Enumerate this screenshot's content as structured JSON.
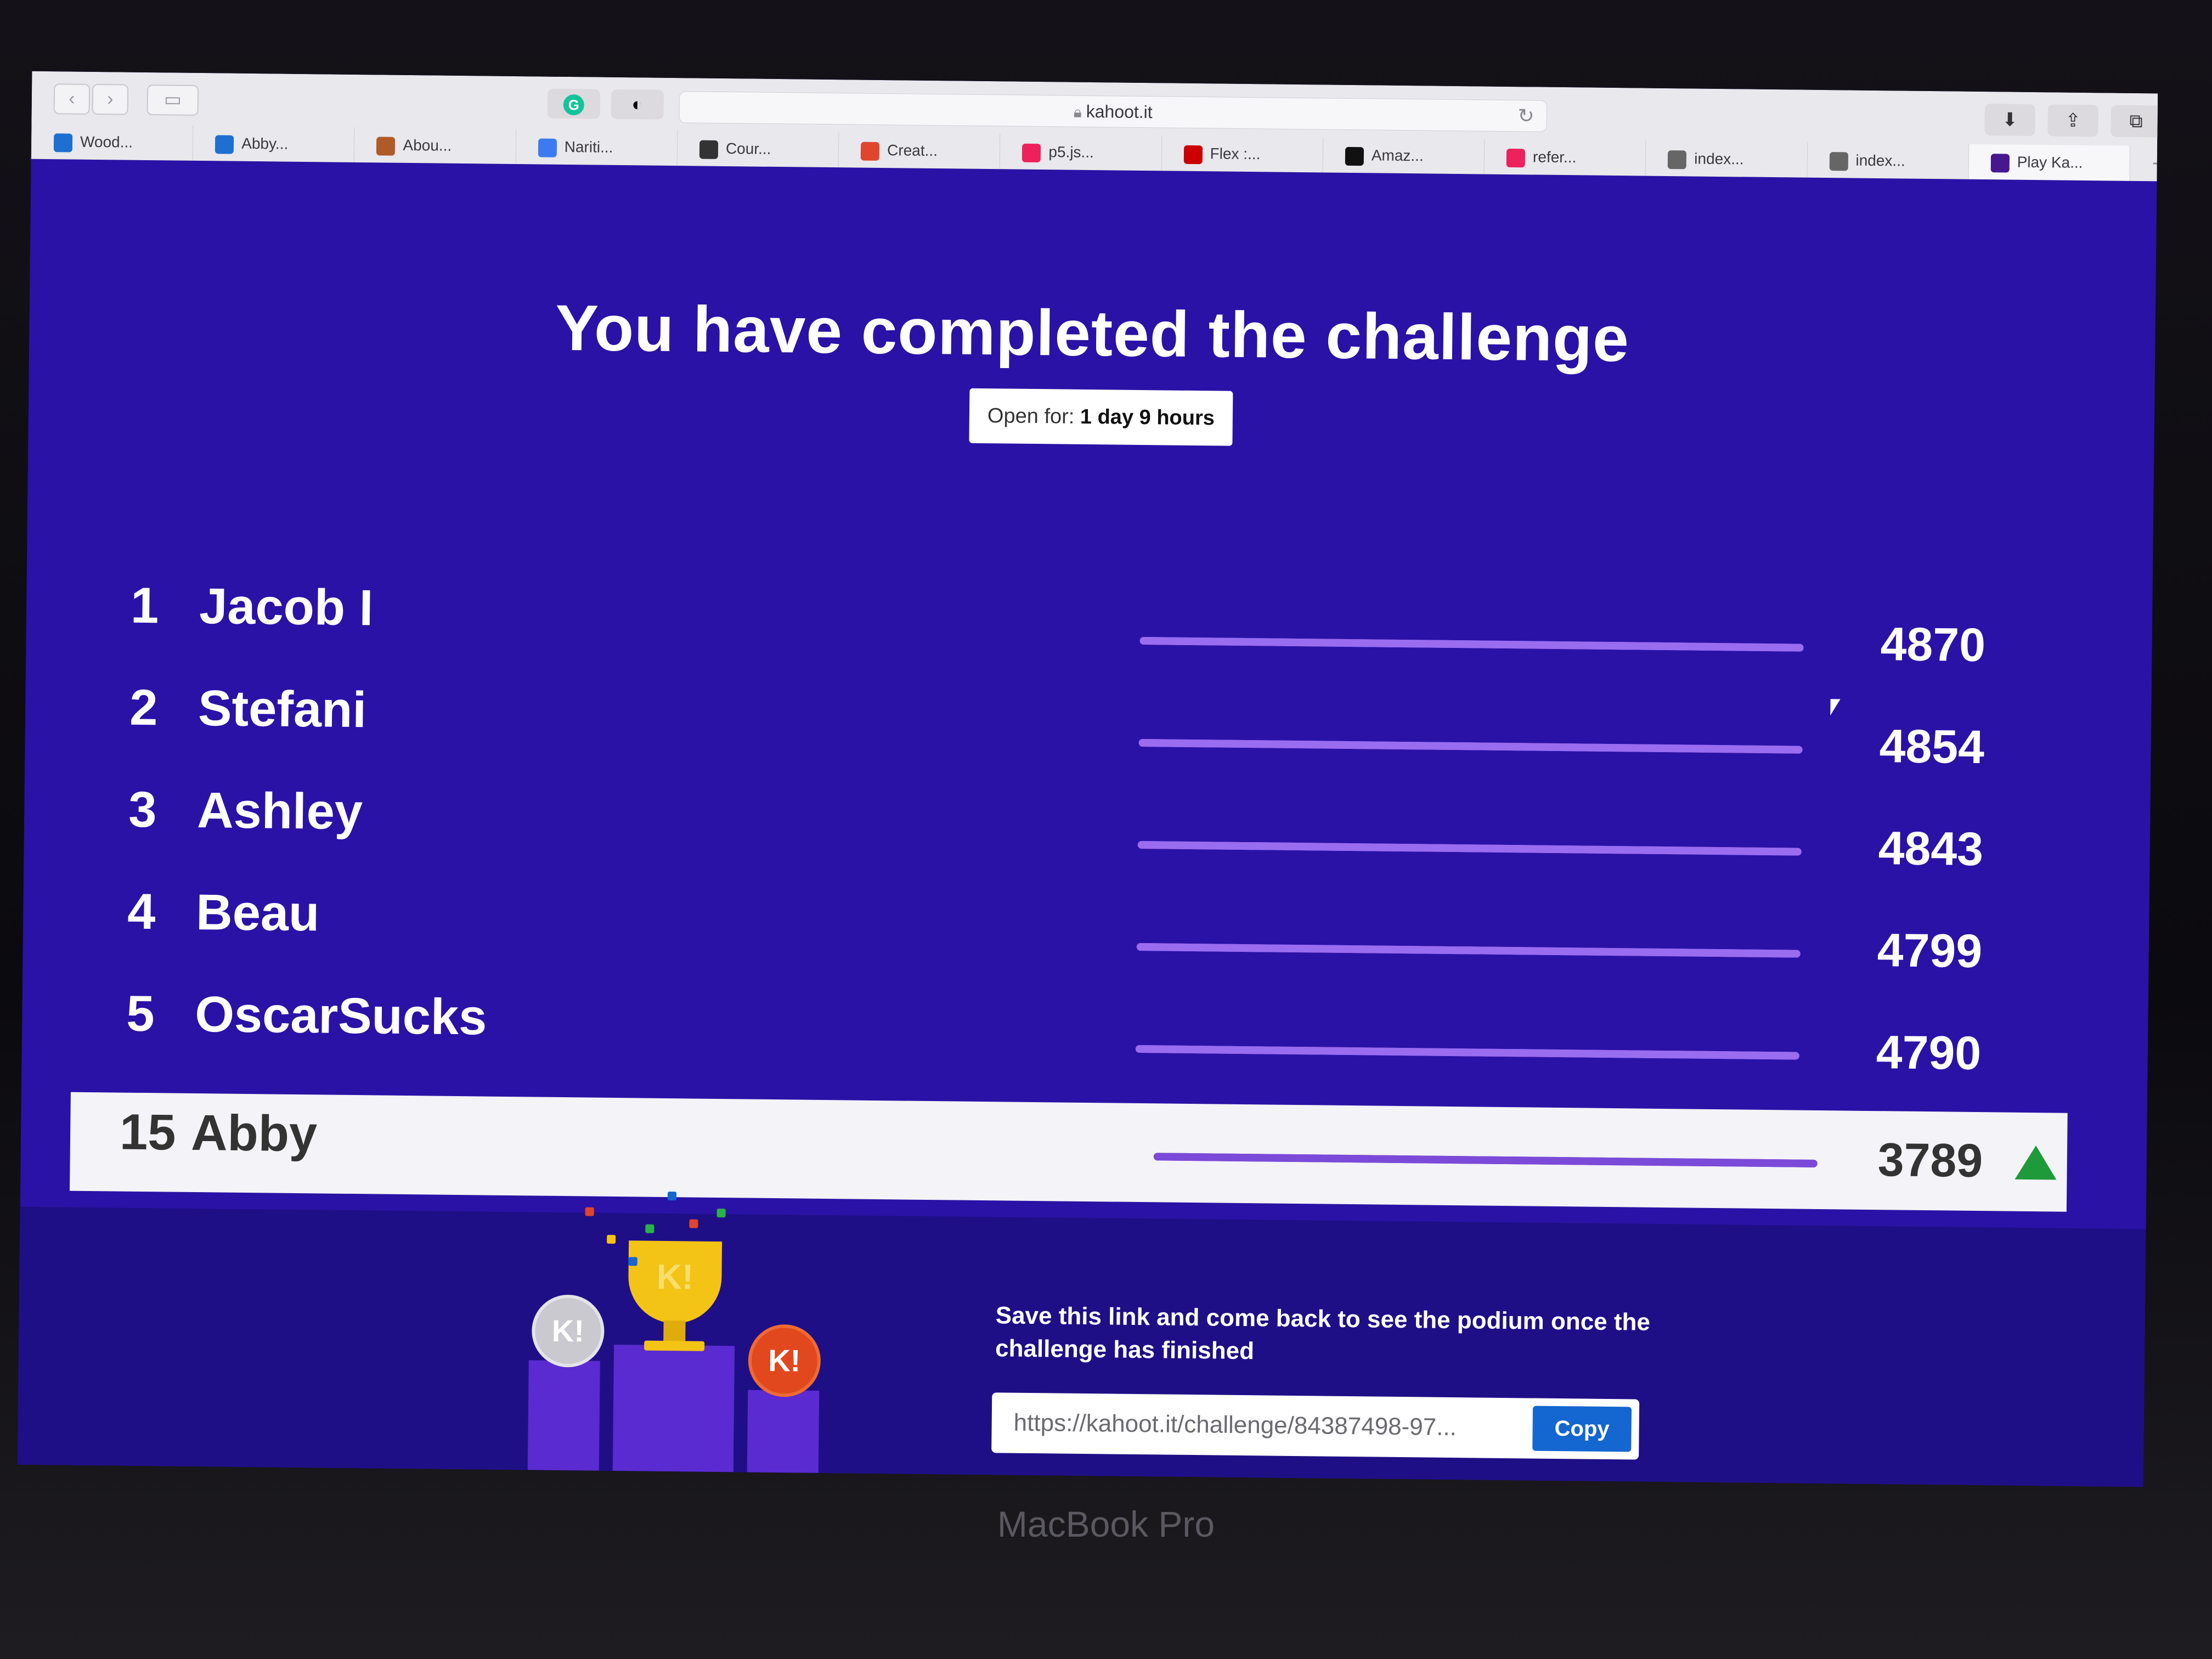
{
  "browser": {
    "address": "kahoot.it",
    "tabs": [
      {
        "label": "Wood...",
        "icon": "outlook-icon",
        "color": "#1f6fd1"
      },
      {
        "label": "Abby...",
        "icon": "outlook-icon",
        "color": "#1f6fd1"
      },
      {
        "label": "Abou...",
        "icon": "app-icon",
        "color": "#b05a2a"
      },
      {
        "label": "Nariti...",
        "icon": "docs-icon",
        "color": "#3b7af0"
      },
      {
        "label": "Cour...",
        "icon": "power-icon",
        "color": "#333333"
      },
      {
        "label": "Creat...",
        "icon": "drive-icon",
        "color": "#e0452e"
      },
      {
        "label": "p5.js...",
        "icon": "asterisk-icon",
        "color": "#ed225d"
      },
      {
        "label": "Flex :...",
        "icon": "target-icon",
        "color": "#cc0000"
      },
      {
        "label": "Amaz...",
        "icon": "amazon-icon",
        "color": "#111111"
      },
      {
        "label": "refer...",
        "icon": "asterisk-icon",
        "color": "#ed225d"
      },
      {
        "label": "index...",
        "icon": "compass-icon",
        "color": "#666666"
      },
      {
        "label": "index...",
        "icon": "compass-icon",
        "color": "#666666"
      },
      {
        "label": "Play Ka...",
        "icon": "kahoot-icon",
        "color": "#46178f"
      }
    ]
  },
  "page": {
    "title": "You have completed the challenge",
    "open_label": "Open for: ",
    "open_value": "1 day 9 hours"
  },
  "leaderboard": [
    {
      "rank": "1",
      "name": "Jacob I",
      "score": "4870",
      "fill": 1.0
    },
    {
      "rank": "2",
      "name": "Stefani",
      "score": "4854",
      "fill": 1.0
    },
    {
      "rank": "3",
      "name": "Ashley",
      "score": "4843",
      "fill": 1.0
    },
    {
      "rank": "4",
      "name": "Beau",
      "score": "4799",
      "fill": 1.0
    },
    {
      "rank": "5",
      "name": "OscarSucks",
      "score": "4790",
      "fill": 1.0
    }
  ],
  "me": {
    "rank": "15",
    "name": "Abby",
    "score": "3789",
    "fill": 1.0,
    "trend": "up-arrow-icon"
  },
  "footer": {
    "save_text": "Save this link and come back to see the podium once the challenge has finished",
    "link": "https://kahoot.it/challenge/84387498-97...",
    "copy_label": "Copy"
  },
  "device": {
    "label": "MacBook Pro"
  },
  "colors": {
    "page_bg": "#2a12a6",
    "bar": "#9a6cf0",
    "copy": "#1466d0",
    "trend": "#1f9a3a"
  }
}
